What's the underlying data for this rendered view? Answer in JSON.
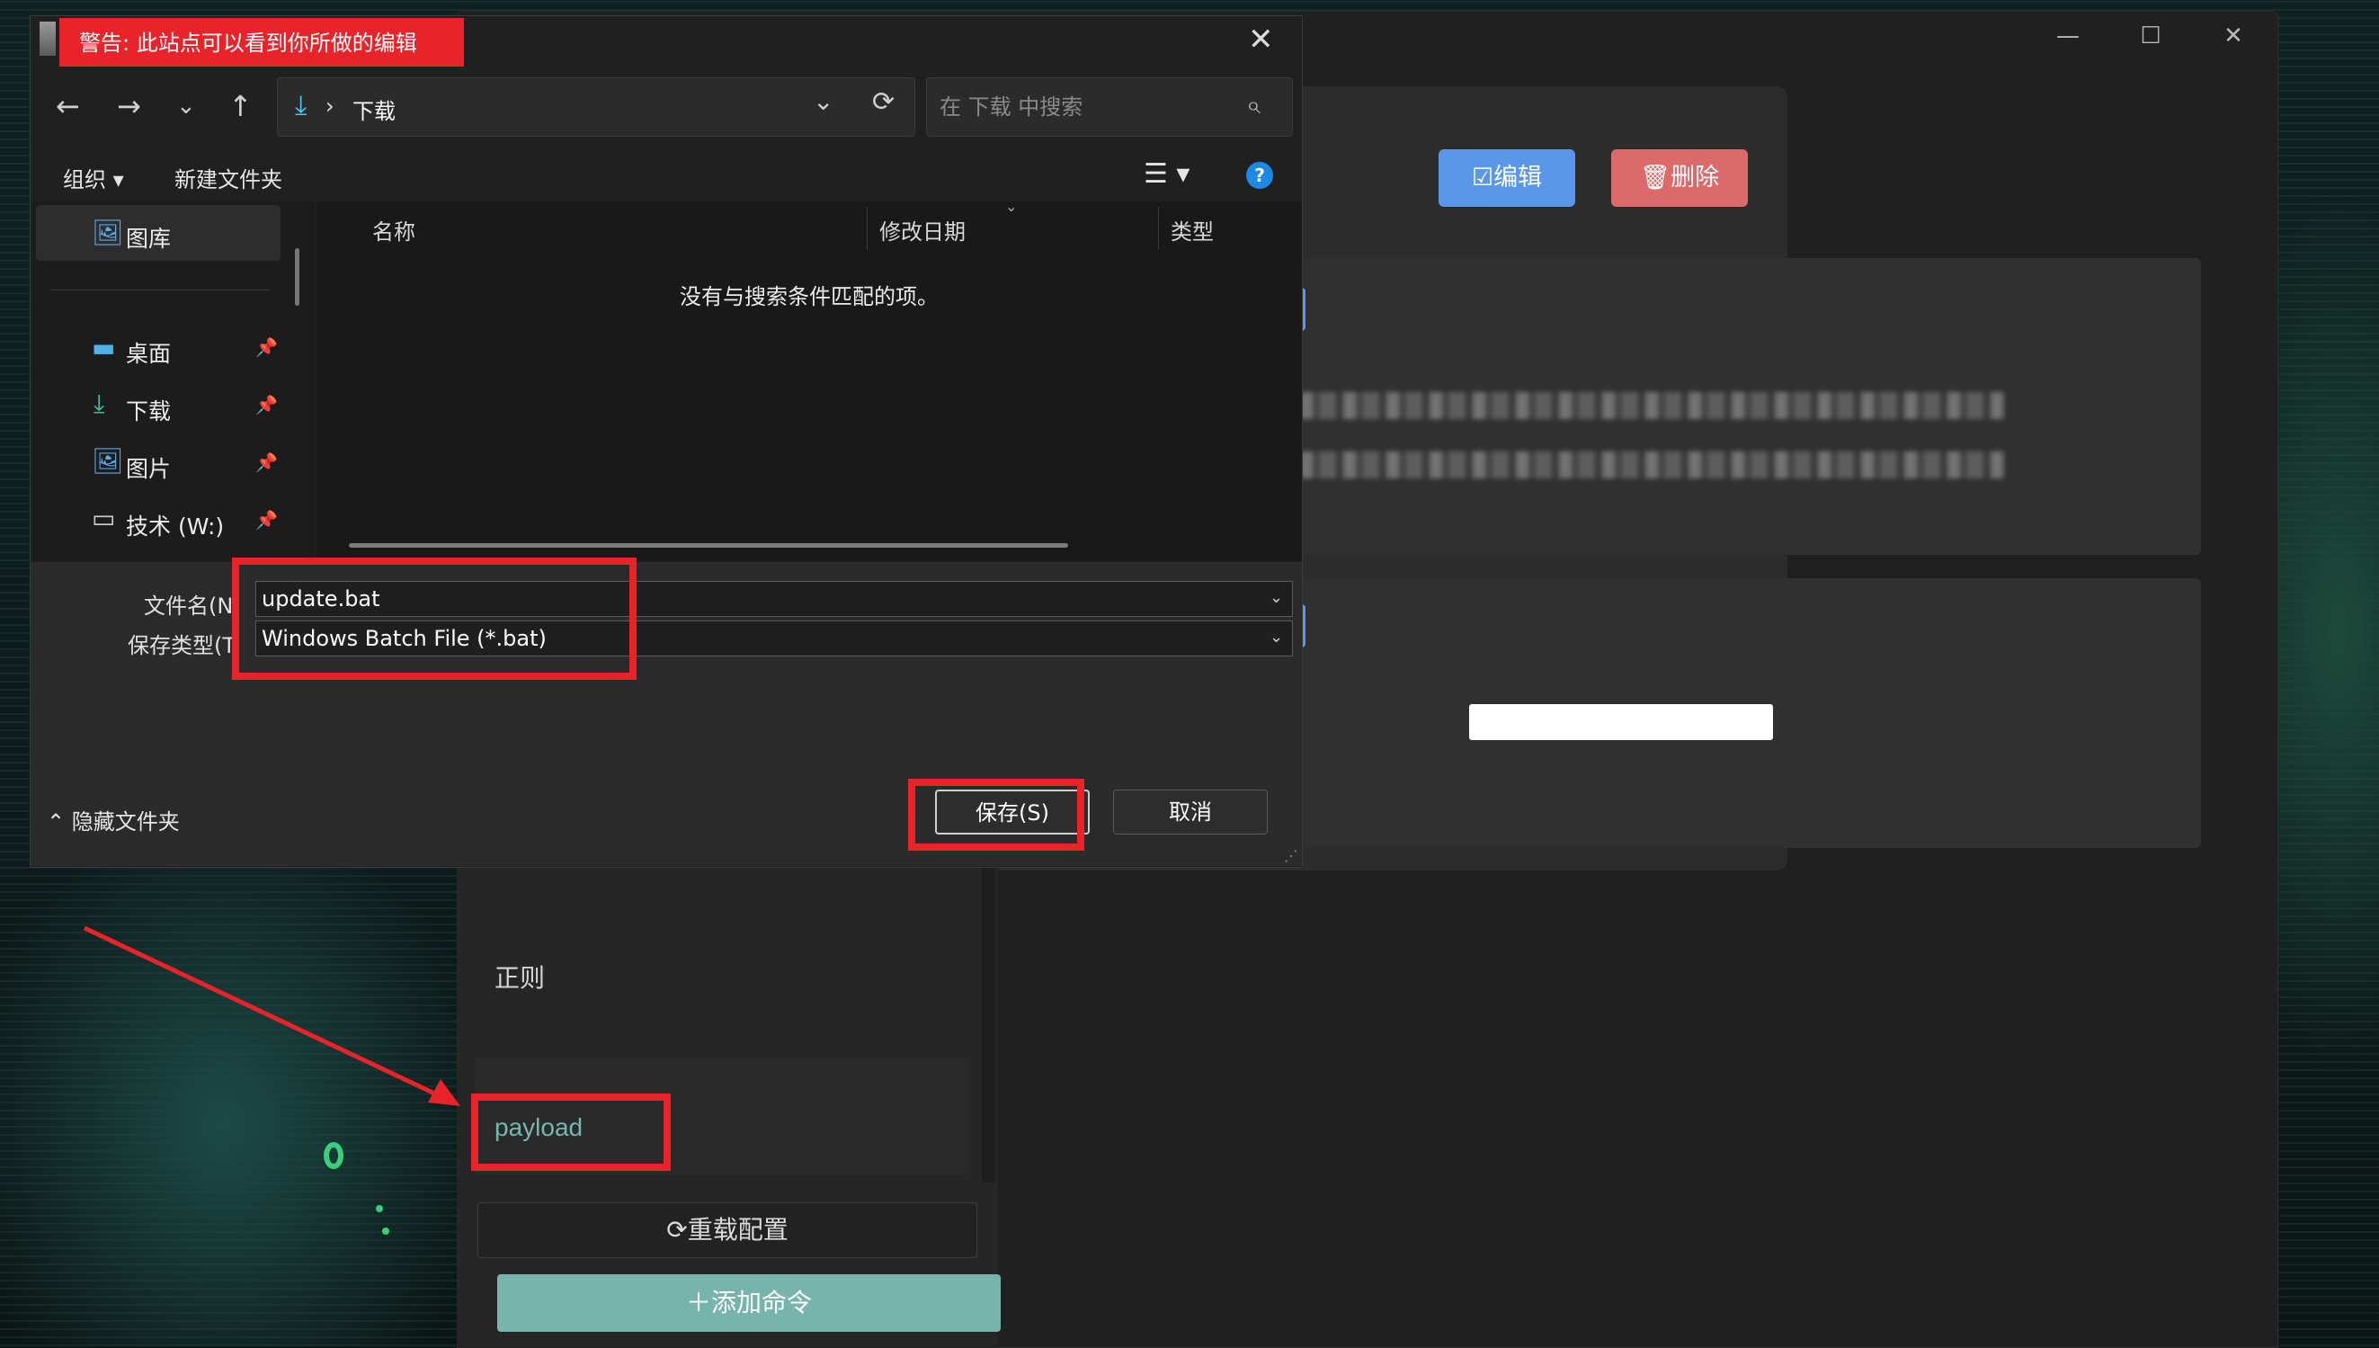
{
  "dialog": {
    "title": "警告: 此站点可以看到你所做的编辑",
    "close_glyph": "✕",
    "nav": {
      "back": "←",
      "forward": "→",
      "recent": "⌄",
      "up": "↑"
    },
    "address": {
      "separator": "›",
      "folder": "下载",
      "chevron": "⌄",
      "refresh": "⟳"
    },
    "search_placeholder": "在 下载 中搜索",
    "toolbar": {
      "organize": "组织 ▾",
      "new_folder": "新建文件夹",
      "view": "☰ ▾",
      "help": "?"
    },
    "sidebar": {
      "items": [
        {
          "label": "图库",
          "icon": "gallery-icon"
        },
        {
          "label": "桌面",
          "icon": "desktop-icon"
        },
        {
          "label": "下载",
          "icon": "download-icon"
        },
        {
          "label": "图片",
          "icon": "pictures-icon"
        },
        {
          "label": "技术 (W:)",
          "icon": "drive-icon"
        }
      ]
    },
    "columns": {
      "name": "名称",
      "modified": "修改日期",
      "type": "类型"
    },
    "empty_message": "没有与搜索条件匹配的项。",
    "filename_label": "文件名(N",
    "filename_value": "update.bat",
    "filetype_label": "保存类型(T",
    "filetype_value": "Windows Batch File (*.bat)",
    "hide_folders": "隐藏文件夹",
    "save_label": "保存(S)",
    "cancel_label": "取消"
  },
  "app": {
    "window_controls": {
      "minimize": "—",
      "maximize": "☐",
      "close": "✕"
    },
    "title": "payload",
    "edit_label": "☑编辑",
    "delete_label": "🗑删除",
    "sidebar": {
      "items": [
        {
          "label": "正则"
        },
        {
          "label": "payload"
        }
      ]
    },
    "reload_label": "⟳重载配置",
    "add_label": "＋添加命令"
  },
  "colors": {
    "accent_teal": "#77b5ac",
    "edit_blue": "#5b97e8",
    "delete_red": "#dc6a6a",
    "annotation_red": "#e8232a"
  }
}
